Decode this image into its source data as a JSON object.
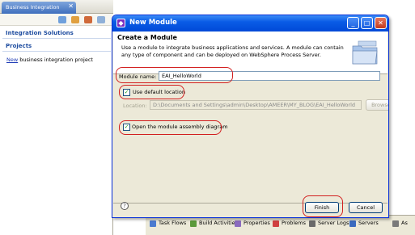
{
  "left_view": {
    "tab_label": "Business Integration",
    "tab_close": "✕",
    "sections": [
      {
        "title": "Integration Solutions"
      },
      {
        "title": "Projects"
      }
    ],
    "link_text": "New",
    "link_rest": " business integration project"
  },
  "dialog": {
    "title": "New Module",
    "window_buttons": {
      "minimize": "_",
      "maximize": "□",
      "close": "✕"
    },
    "header_title": "Create a Module",
    "header_desc": "Use a module to integrate business applications and services. A module can contain any type of component and can be deployed on WebSphere Process Server.",
    "module_name_label": "Module name:",
    "module_name_value": "EAI_HelloWorld",
    "use_default_label": "Use default location",
    "location_label": "Location:",
    "location_value": "D:\\Documents and Settings\\admin\\Desktop\\AMEER\\MY_BLOG\\EAI_HelloWorld",
    "browse_label": "Browse...",
    "open_assembly_label": "Open the module assembly diagram",
    "finish_label": "Finish",
    "cancel_label": "Cancel",
    "help_glyph": "?"
  },
  "bottom_tabs": [
    {
      "label": "Task Flows",
      "icon": "task-flows-icon",
      "color": "#4a7bd0"
    },
    {
      "label": "Build Activitie",
      "icon": "build-activities-icon",
      "color": "#5a9a3a"
    },
    {
      "label": "Properties",
      "icon": "properties-icon",
      "color": "#8a6bbf"
    },
    {
      "label": "Problems",
      "icon": "problems-icon",
      "color": "#d04040"
    },
    {
      "label": "Server Logs",
      "icon": "server-logs-icon",
      "color": "#6a6a6a"
    },
    {
      "label": "Servers",
      "icon": "servers-icon",
      "color": "#3a6abf"
    },
    {
      "label": "As",
      "icon": "assembly-icon",
      "color": "#7a7a7a"
    }
  ],
  "colors": {
    "title_blue": "#0a5ce6",
    "link": "#1f3cb6",
    "section": "#1f4da0",
    "annotation_red": "#d21f1f"
  }
}
